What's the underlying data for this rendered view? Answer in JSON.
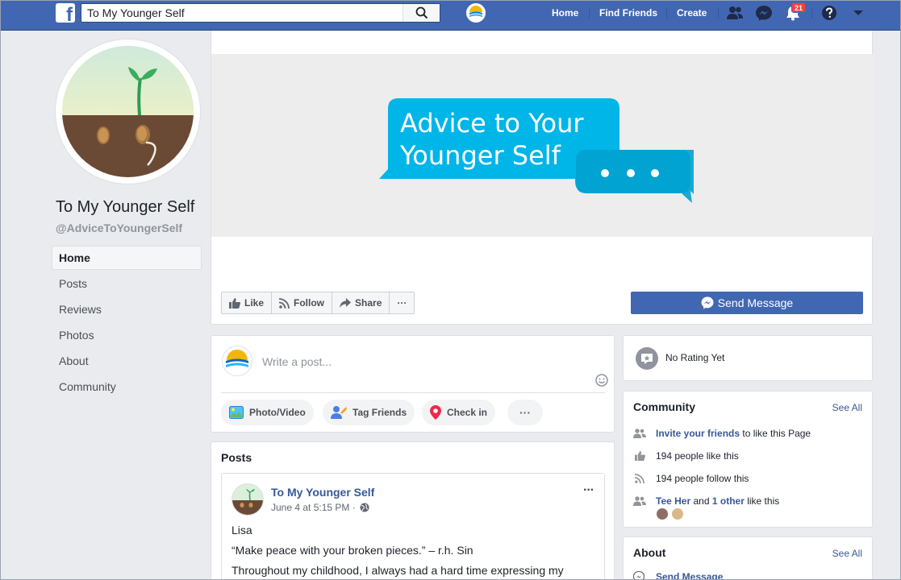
{
  "topbar": {
    "search_value": "To My Younger Self",
    "search_placeholder": "Search",
    "nav": {
      "home": "Home",
      "find_friends": "Find Friends",
      "create": "Create"
    },
    "notification_count": "21",
    "icons": [
      "facebook-logo",
      "search-icon",
      "page-logo",
      "friends-icon",
      "messenger-icon",
      "bell-icon",
      "help-icon",
      "caret-down-icon"
    ],
    "brand_color": "#4267b2"
  },
  "page": {
    "name": "To My Younger Self",
    "handle": "@AdviceToYoungerSelf"
  },
  "sidebar": {
    "items": [
      {
        "label": "Home",
        "active": true
      },
      {
        "label": "Posts"
      },
      {
        "label": "Reviews"
      },
      {
        "label": "Photos"
      },
      {
        "label": "About"
      },
      {
        "label": "Community"
      }
    ]
  },
  "cover": {
    "line1": "Advice to Your",
    "line2": "Younger Self",
    "bubble_color": "#00b2e2"
  },
  "actions": {
    "like": "Like",
    "follow": "Follow",
    "share": "Share",
    "more": "···",
    "send_message": "Send Message"
  },
  "composer": {
    "placeholder": "Write a post...",
    "photo_video": "Photo/Video",
    "tag_friends": "Tag Friends",
    "check_in": "Check in",
    "more": "···"
  },
  "posts": {
    "title": "Posts",
    "post": {
      "author": "To My Younger Self",
      "time": "June 4 at 5:15 PM ·",
      "more": "···",
      "lines": [
        "Lisa",
        "“Make peace with your broken pieces.” – r.h. Sin",
        "Throughout my childhood, I always had a hard time expressing my"
      ]
    }
  },
  "rating": {
    "text": "No Rating Yet"
  },
  "community": {
    "title": "Community",
    "see_all": "See All",
    "invite_link": "Invite your friends",
    "invite_rest": "to like this Page",
    "likes": "194 people like this",
    "follows": "194 people follow this",
    "friend_name": "Tee Her",
    "and_text": "and",
    "other_link": "1 other",
    "like_text": "like this"
  },
  "about": {
    "title": "About",
    "see_all": "See All",
    "send_message": "Send Message"
  }
}
